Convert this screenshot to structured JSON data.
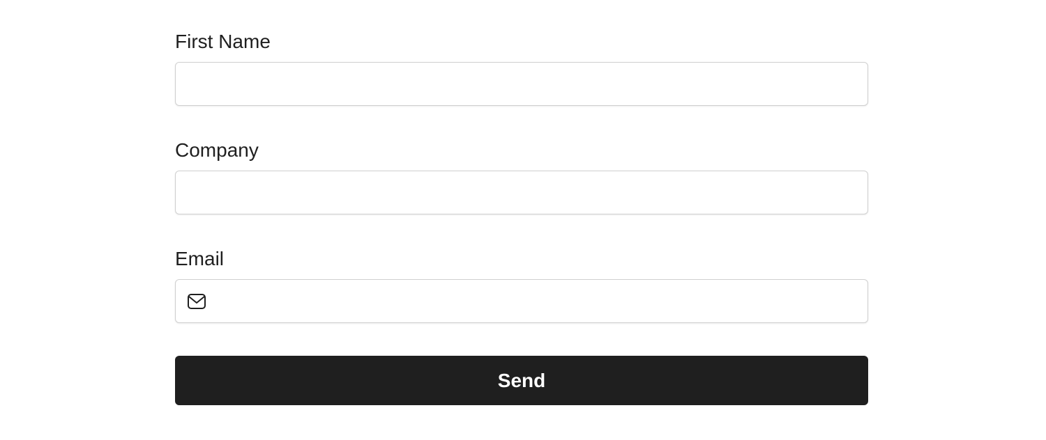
{
  "form": {
    "first_name": {
      "label": "First Name",
      "value": "",
      "placeholder": ""
    },
    "company": {
      "label": "Company",
      "value": "",
      "placeholder": ""
    },
    "email": {
      "label": "Email",
      "value": "",
      "placeholder": "",
      "icon": "mail-icon"
    },
    "submit_label": "Send"
  },
  "colors": {
    "text": "#1f1f1f",
    "button_bg": "#1f1f1f",
    "button_text": "#ffffff",
    "field_border": "#cfcfcf",
    "background": "#ffffff"
  }
}
